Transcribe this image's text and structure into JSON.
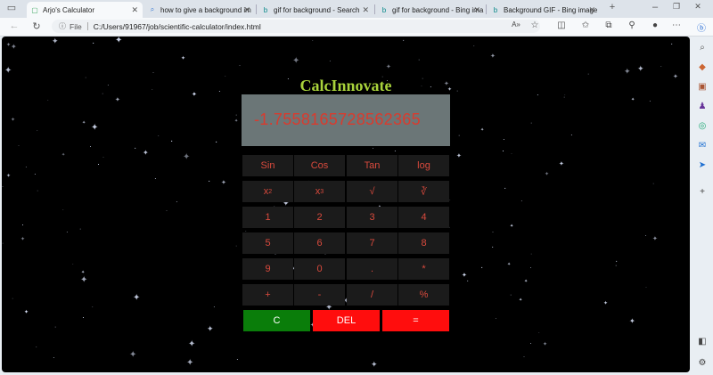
{
  "tabs": [
    {
      "label": "Arjo's Calculator",
      "active": true,
      "icon": "page-icon"
    },
    {
      "label": "how to give a background im",
      "active": false,
      "icon": "search-icon"
    },
    {
      "label": "gif for background - Search",
      "active": false,
      "icon": "bing-icon"
    },
    {
      "label": "gif for background - Bing ima",
      "active": false,
      "icon": "bing-icon"
    },
    {
      "label": "Background GIF - Bing image",
      "active": false,
      "icon": "bing-icon"
    }
  ],
  "address": {
    "scheme_label": "File",
    "url": "C:/Users/91967/job/scientific-calculator/index.html"
  },
  "calculator": {
    "title": "CalcInnovate",
    "display": "-1.7558165728562365",
    "rows": [
      [
        "Sin",
        "Cos",
        "Tan",
        "log"
      ],
      [
        "x2",
        "x3",
        "√",
        "∛"
      ],
      [
        "1",
        "2",
        "3",
        "4"
      ],
      [
        "5",
        "6",
        "7",
        "8"
      ],
      [
        "9",
        "0",
        ".",
        "*"
      ],
      [
        "+",
        "-",
        "/",
        "%"
      ]
    ],
    "clear_label": "C",
    "delete_label": "DEL",
    "equals_label": "=",
    "colors": {
      "clear": "#0a7d0a",
      "delete": "#ff0d0d",
      "equals": "#ff0d0d",
      "title": "#a9d33b",
      "text": "#d94a3d"
    }
  }
}
